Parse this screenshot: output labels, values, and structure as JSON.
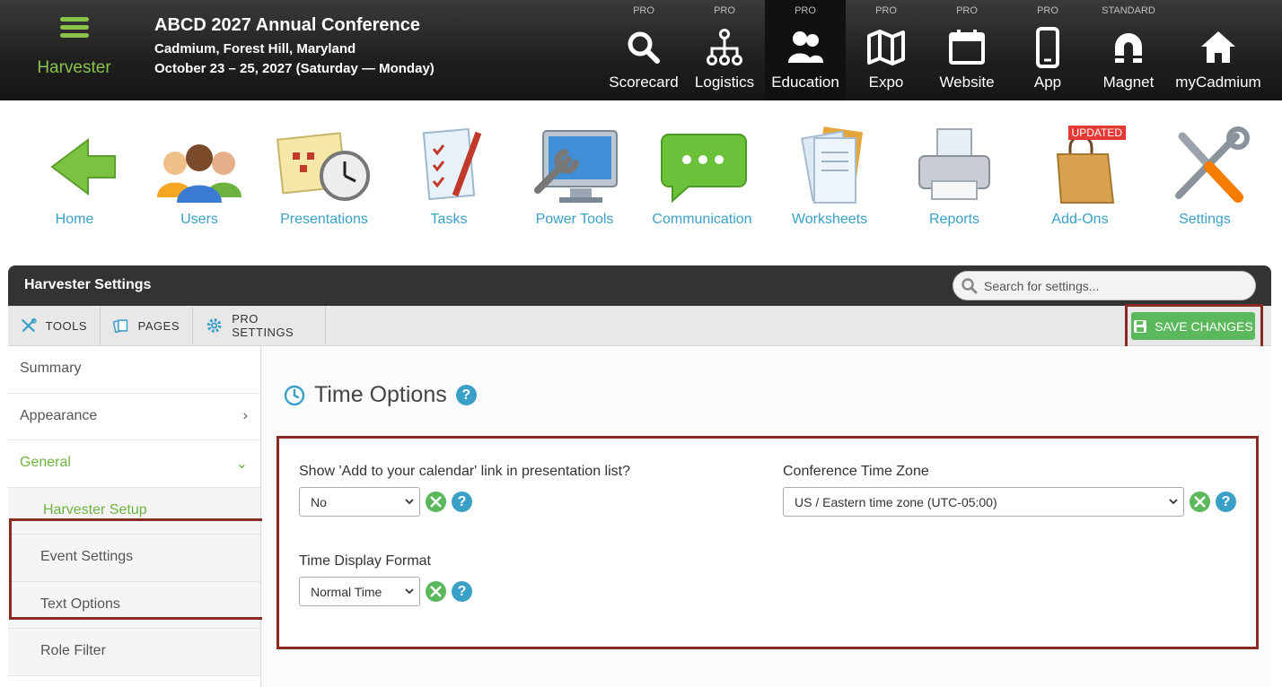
{
  "brand": {
    "name": "Harvester"
  },
  "conference": {
    "title": "ABCD 2027 Annual Conference",
    "location": "Cadmium, Forest Hill, Maryland",
    "dates": "October 23 – 25, 2027 (Saturday — Monday)"
  },
  "modules": [
    {
      "tier": "PRO",
      "label": "Scorecard",
      "icon": "search-icon"
    },
    {
      "tier": "PRO",
      "label": "Logistics",
      "icon": "hierarchy-icon"
    },
    {
      "tier": "PRO",
      "label": "Education",
      "icon": "people-icon",
      "active": true
    },
    {
      "tier": "PRO",
      "label": "Expo",
      "icon": "map-icon"
    },
    {
      "tier": "PRO",
      "label": "Website",
      "icon": "calendar-icon"
    },
    {
      "tier": "PRO",
      "label": "App",
      "icon": "phone-icon"
    },
    {
      "tier": "STANDARD",
      "label": "Magnet",
      "icon": "magnet-icon"
    },
    {
      "tier": "",
      "label": "myCadmium",
      "icon": "home-icon"
    }
  ],
  "menu": [
    {
      "label": "Home",
      "icon": "green-arrow-icon"
    },
    {
      "label": "Users",
      "icon": "users-icon"
    },
    {
      "label": "Presentations",
      "icon": "calendar-clock-icon"
    },
    {
      "label": "Tasks",
      "icon": "checklist-icon"
    },
    {
      "label": "Power Tools",
      "icon": "monitor-wrench-icon"
    },
    {
      "label": "Communication",
      "icon": "chat-bubble-icon"
    },
    {
      "label": "Worksheets",
      "icon": "documents-icon"
    },
    {
      "label": "Reports",
      "icon": "printer-icon"
    },
    {
      "label": "Add-Ons",
      "icon": "shopping-bag-icon",
      "badge": "UPDATED"
    },
    {
      "label": "Settings",
      "icon": "tools-icon"
    }
  ],
  "panel": {
    "title": "Harvester Settings",
    "search_placeholder": "Search for settings...",
    "toolbar": {
      "tools": "TOOLS",
      "pages": "PAGES",
      "pro_settings": "PRO SETTINGS",
      "save": "SAVE CHANGES"
    }
  },
  "sidebar": {
    "items": [
      {
        "label": "Summary"
      },
      {
        "label": "Appearance",
        "chevron": "›"
      },
      {
        "label": "General",
        "chevron": "⌄"
      },
      {
        "label": "Harvester Setup"
      },
      {
        "label": "Event Settings"
      },
      {
        "label": "Text Options"
      },
      {
        "label": "Role Filter"
      }
    ]
  },
  "content": {
    "heading": "Time Options",
    "help": "?",
    "fields": {
      "calendar_link": {
        "label": "Show 'Add to your calendar' link in presentation list?",
        "value": "No"
      },
      "timezone": {
        "label": "Conference Time Zone",
        "value": "US / Eastern time zone (UTC-05:00)"
      },
      "time_format": {
        "label": "Time Display Format",
        "value": "Normal Time"
      }
    }
  },
  "colors": {
    "accent_green": "#5cb85c",
    "link_blue": "#3aa0c7",
    "highlight_border": "#8b2a22"
  }
}
